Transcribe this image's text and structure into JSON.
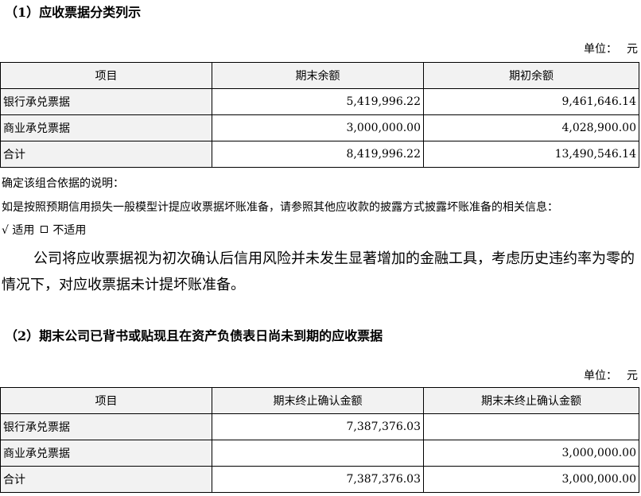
{
  "section1": {
    "heading": "（1）应收票据分类列示",
    "unit_label": "单位：",
    "unit_value": "元",
    "headers": [
      "项目",
      "期末余额",
      "期初余额"
    ],
    "rows": [
      {
        "item": "银行承兑票据",
        "end": "5,419,996.22",
        "begin": "9,461,646.14"
      },
      {
        "item": "商业承兑票据",
        "end": "3,000,000.00",
        "begin": "4,028,900.00"
      },
      {
        "item": "合计",
        "end": "8,419,996.22",
        "begin": "13,490,546.14"
      }
    ]
  },
  "notes": {
    "basis": "确定该组合依据的说明：",
    "model": "如是按照预期信用损失一般模型计提应收票据坏账准备，请参照其他应收款的披露方式披露坏账准备的相关信息：",
    "check_mark": "√",
    "applicable": "适用",
    "not_applicable": "不适用",
    "paragraph": "公司将应收票据视为初次确认后信用风险并未发生显著增加的金融工具，考虑历史违约率为零的情况下，对应收票据未计提坏账准备。"
  },
  "section2": {
    "heading": "（2）期末公司已背书或贴现且在资产负债表日尚未到期的应收票据",
    "unit_label": "单位：",
    "unit_value": "元",
    "headers": [
      "项目",
      "期末终止确认金额",
      "期末未终止确认金额"
    ],
    "rows": [
      {
        "item": "银行承兑票据",
        "derecognized": "7,387,376.03",
        "not_derecognized": ""
      },
      {
        "item": "商业承兑票据",
        "derecognized": "",
        "not_derecognized": "3,000,000.00"
      },
      {
        "item": "合计",
        "derecognized": "7,387,376.03",
        "not_derecognized": "3,000,000.00"
      }
    ]
  }
}
